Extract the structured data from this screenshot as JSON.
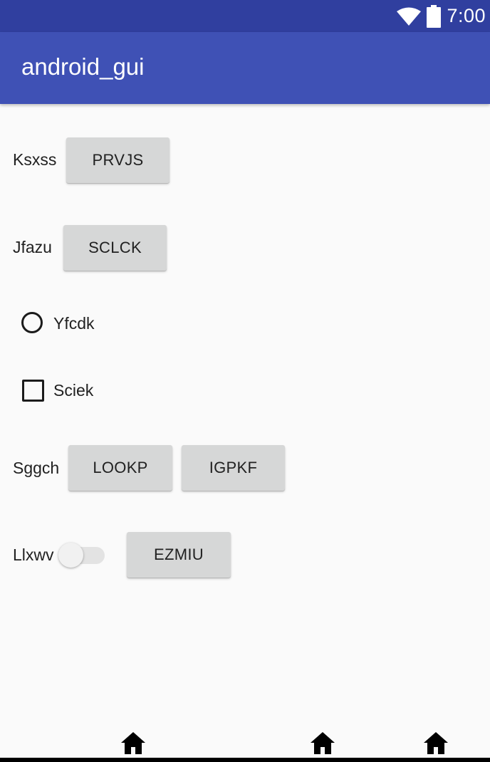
{
  "status_bar": {
    "time": "7:00",
    "icons": [
      "wifi-icon",
      "battery-icon"
    ],
    "background": "#303f9f"
  },
  "app_bar": {
    "title": "android_gui",
    "background": "#3f51b5"
  },
  "rows": {
    "row1": {
      "label": "Ksxss",
      "button": "PRVJS"
    },
    "row2": {
      "label": "Jfazu",
      "button": "SCLCK"
    },
    "radio": {
      "label": "Yfcdk",
      "checked": false
    },
    "checkbox": {
      "label": "Sciek",
      "checked": false
    },
    "row5": {
      "label": "Sggch",
      "button1": "LOOKP",
      "button2": "IGPKF"
    },
    "row6": {
      "label": "Llxwv",
      "switch_on": false,
      "button": "EZMIU"
    }
  },
  "nav_bar": {
    "icons": [
      "home-icon",
      "home-icon",
      "home-icon"
    ]
  }
}
